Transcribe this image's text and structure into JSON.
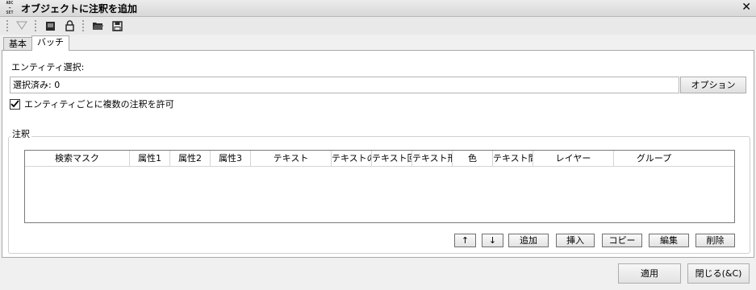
{
  "window": {
    "app_icon_text": "ABC→SET",
    "title": "オブジェクトに注釈を追加",
    "close_glyph": "✕"
  },
  "toolbar": {
    "icons": [
      "filter-icon",
      "preview-icon",
      "lock-icon",
      "open-folder-icon",
      "save-icon"
    ]
  },
  "tabs": [
    {
      "label": "基本",
      "active": false
    },
    {
      "label": "バッチ",
      "active": true
    }
  ],
  "entity": {
    "label": "エンティティ選択:",
    "selected_text": "選択済み: 0",
    "options_label": "オプション",
    "allow_multiple_label": "エンティティごとに複数の注釈を許可",
    "allow_multiple_checked": true
  },
  "annotations": {
    "legend": "注釈",
    "columns": [
      "検索マスク",
      "属性1",
      "属性2",
      "属性3",
      "テキスト",
      "テキストの高",
      "テキスト回転",
      "テキスト形式",
      "色",
      "テキスト間隔",
      "レイヤー",
      "グループ"
    ],
    "rows": [],
    "buttons": {
      "up": "↑",
      "down": "↓",
      "add": "追加",
      "insert": "挿入",
      "copy": "コピー",
      "edit": "編集",
      "delete": "削除"
    }
  },
  "footer": {
    "apply": "適用",
    "close": "閉じる(&C)"
  }
}
